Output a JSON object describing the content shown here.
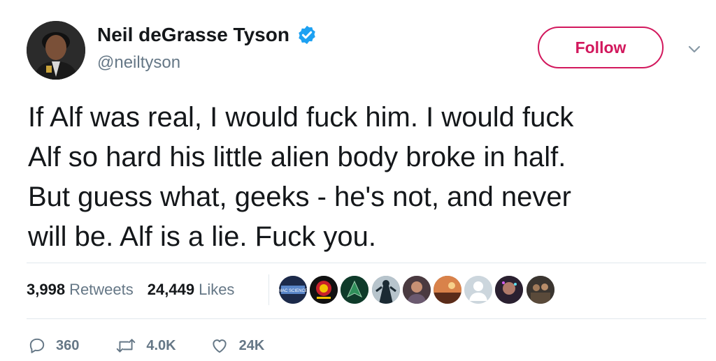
{
  "author": {
    "display_name": "Neil deGrasse Tyson",
    "handle": "@neiltyson",
    "verified": true,
    "avatar_icon": "person-avatar"
  },
  "follow_button": {
    "label": "Follow",
    "color": "#d2185d"
  },
  "menu_icon": "chevron-down-icon",
  "tweet": {
    "text": "If Alf was real, I would fuck him. I would fuck\nAlf so hard his little alien body broke in half.\nBut guess what, geeks - he's not, and never\nwill be. Alf is a lie. Fuck you."
  },
  "stats": {
    "retweets_count": "3,998",
    "retweets_label": "Retweets",
    "likes_count": "24,449",
    "likes_label": "Likes"
  },
  "likers": [
    {
      "name": "liker-avatar-mac-science",
      "color": "#1c2a4a",
      "logo_text": "MAC SCIENCE"
    },
    {
      "name": "liker-avatar-red-logo",
      "color": "#111111"
    },
    {
      "name": "liker-avatar-green-arrow",
      "color": "#0f3b2a"
    },
    {
      "name": "liker-avatar-figure",
      "color": "#7a8a96"
    },
    {
      "name": "liker-avatar-person",
      "color": "#4a3a40"
    },
    {
      "name": "liker-avatar-landscape",
      "color": "#8a4a2a"
    },
    {
      "name": "liker-avatar-default",
      "color": "#ccd6dd"
    },
    {
      "name": "liker-avatar-dark",
      "color": "#2a2030"
    },
    {
      "name": "liker-avatar-group",
      "color": "#3a3530"
    }
  ],
  "actions": {
    "replies": "360",
    "retweets": "4.0K",
    "likes": "24K"
  }
}
